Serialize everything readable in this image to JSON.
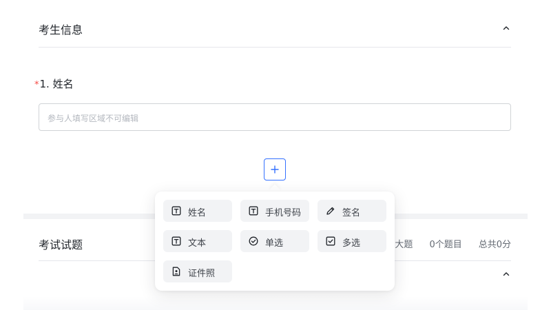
{
  "candidate_section": {
    "title": "考生信息"
  },
  "question": {
    "required_mark": "*",
    "label": "1. 姓名",
    "placeholder": "参与人填写区域不可编辑"
  },
  "exam_section": {
    "title": "考试试题",
    "stat_sections": "大题",
    "stat_questions": "0个题目",
    "stat_total": "总共0分"
  },
  "add_menu": {
    "options": [
      {
        "label": "姓名",
        "icon": "text-t-icon"
      },
      {
        "label": "手机号码",
        "icon": "text-t-icon"
      },
      {
        "label": "签名",
        "icon": "pen-icon"
      },
      {
        "label": "文本",
        "icon": "text-t-icon"
      },
      {
        "label": "单选",
        "icon": "radio-check-icon"
      },
      {
        "label": "多选",
        "icon": "checkbox-icon"
      },
      {
        "label": "证件照",
        "icon": "id-photo-icon"
      }
    ]
  },
  "colors": {
    "primary": "#3370ff",
    "required": "#f54a45"
  }
}
